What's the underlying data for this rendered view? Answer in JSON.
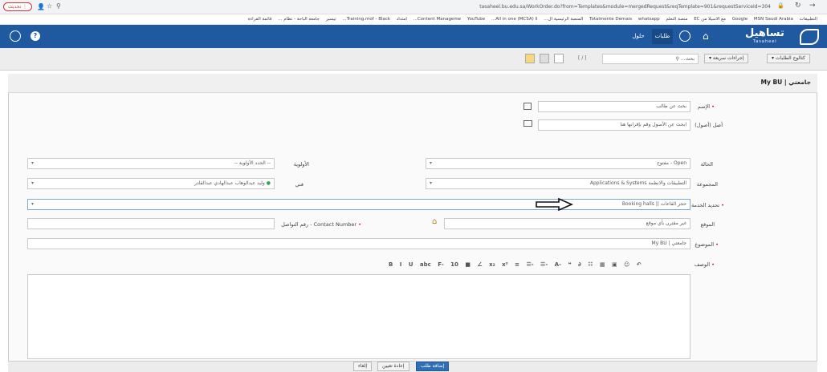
{
  "browser": {
    "url": "tasaheel.bu.edu.sa/WorkOrder.do?from=Templates&module=mergedRequest&reqTemplate=901&requestServiceId=304",
    "update_button": "تحديث",
    "bookmarks": [
      "التطبيقات",
      "MSN Saudi Arabia",
      "Google",
      "مع الاسيلا من EC",
      "منصة التعلم",
      "whatsapp",
      "Totalmente Demais",
      "المنصة الرئيسية ال...",
      "All in one (MCSA) li...",
      "YouTube",
      "Content Manageme...",
      "امتداد",
      "Training.mof - Black...",
      "تيسير",
      "جامعة الباحة - نظام ...",
      "قائمة القراءة"
    ]
  },
  "nav": {
    "brand": "تساهيل",
    "brand_sub": "Tasaheel",
    "items": [
      "طلبات",
      "حلول"
    ]
  },
  "toolbar": {
    "catalog": "كتالوج الطلبات",
    "quick": "إجراءات سريعة",
    "search_placeholder": "بحث...",
    "page": "[ / ]"
  },
  "panel": {
    "title": "جامعتي | My BU"
  },
  "form": {
    "name_label": "الإسم",
    "name_placeholder": "بحث عن طالب",
    "assets_label": "أصل (أصول)",
    "assets_placeholder": "ابحث عن الأصول وقم بإقرانها هنا",
    "status_label": "الحالة",
    "status_value": "Open - مفتوح",
    "priority_label": "الأولوية",
    "priority_value": "-- الحدد الأولوية --",
    "group_label": "المجموعة",
    "group_value": "التطبيقات والانظمة Applications & Systems",
    "tech_label": "فني",
    "tech_value": "وليد عبدالوهاب عبدالهادي عبدالقادر",
    "service_label": "تحديد الخدمة",
    "service_value": "حجز القاعات || Booking halls",
    "site_label": "الموقع",
    "site_value": "غير مقترن بأي موقع",
    "contact_label": "رقم التواصل - Contact Number",
    "subject_label": "الموضوع",
    "subject_value": "جامعتي | My BU",
    "desc_label": "الوصف",
    "editor_tools": "B I U abc F- 10 ■ ∠ x₂ x² ≡ ☰- ☰- A- ❝ ∂ ☷ ▦ ▣ ☺ ↶",
    "font_size": "10"
  },
  "buttons": {
    "submit": "إضافة طلب",
    "reset": "إعادة تعيين",
    "cancel": "إلغاء"
  },
  "colors": {
    "nav": "#1f5aa0",
    "submit": "#2f6fb5",
    "required": "#dd0000"
  }
}
